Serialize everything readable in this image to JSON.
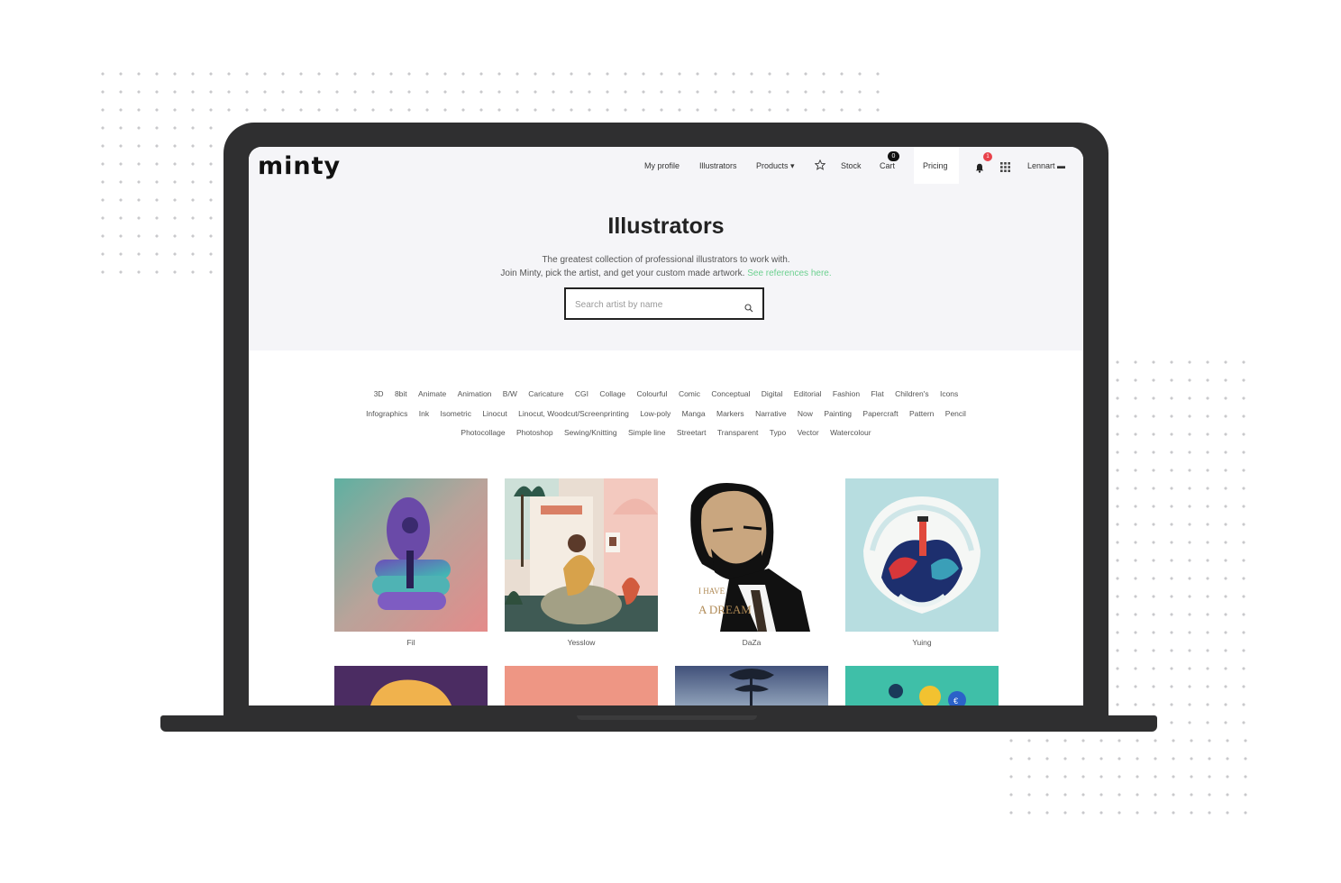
{
  "site": {
    "logo": "minty"
  },
  "nav": {
    "items": [
      {
        "label": "My profile"
      },
      {
        "label": "Illustrators"
      },
      {
        "label": "Products ▾"
      },
      {
        "label": "Stock"
      },
      {
        "label": "Cart"
      },
      {
        "label": "Pricing"
      },
      {
        "label": "Lennart ▬"
      }
    ],
    "cart_count": "0",
    "notification_count": "1",
    "icons": [
      "star-icon",
      "bell-icon",
      "grid-icon"
    ]
  },
  "hero": {
    "title": "Illustrators",
    "line1": "The greatest collection of professional illustrators to work with.",
    "line2": "Join Minty, pick the artist, and get your custom made artwork.",
    "link": "See references here.",
    "search_placeholder": "Search artist by name"
  },
  "tags": [
    "3D",
    "8bit",
    "Animate",
    "Animation",
    "B/W",
    "Caricature",
    "CGI",
    "Collage",
    "Colourful",
    "Comic",
    "Conceptual",
    "Digital",
    "Editorial",
    "Fashion",
    "Flat",
    "Children's",
    "Icons",
    "Infographics",
    "Ink",
    "Isometric",
    "Linocut",
    "Linocut, Woodcut/Screenprinting",
    "Low-poly",
    "Manga",
    "Markers",
    "Narrative",
    "Now",
    "Painting",
    "Papercraft",
    "Pattern",
    "Pencil",
    "Photocollage",
    "Photoshop",
    "Sewing/Knitting",
    "Simple line",
    "Streetart",
    "Transparent",
    "Typo",
    "Vector",
    "Watercolour"
  ],
  "artists": [
    {
      "name": "Fil"
    },
    {
      "name": "Yesslow"
    },
    {
      "name": "DaZa"
    },
    {
      "name": "Yuing"
    }
  ],
  "artwork_text": {
    "dream": "I HAVE A DREAM"
  },
  "colors": {
    "accent_link": "#6cd08f",
    "badge_red": "#e8414a",
    "device": "#2f2f30",
    "hero_bg": "#f5f5f8"
  }
}
